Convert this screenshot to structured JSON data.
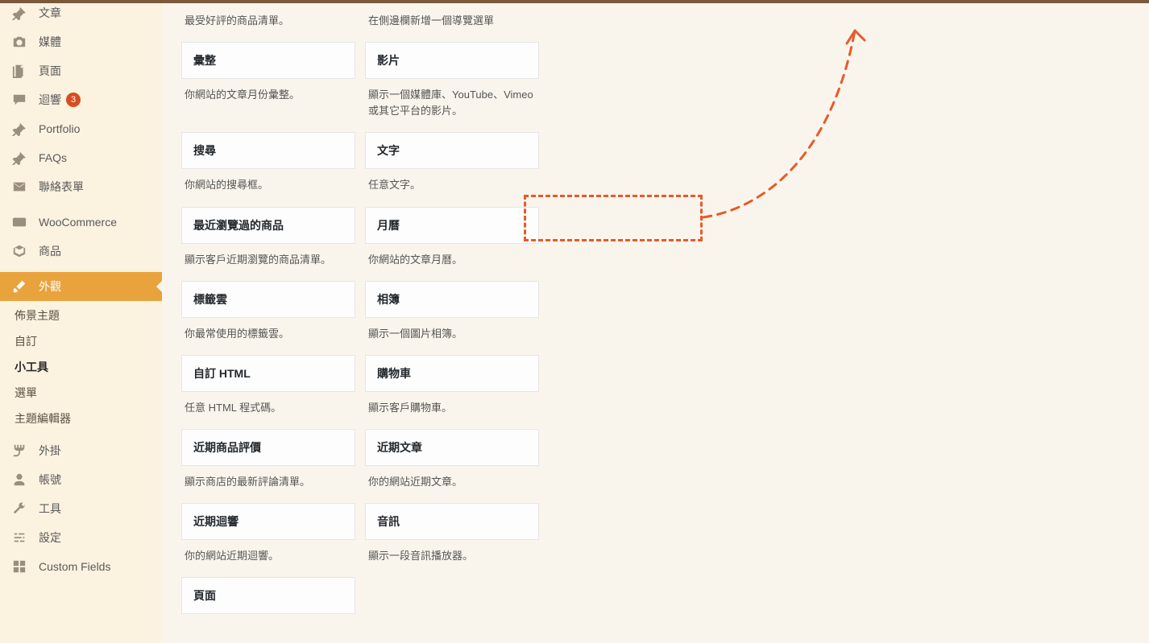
{
  "sidebar": {
    "items": [
      {
        "key": "posts",
        "label": "文章",
        "icon": "pin",
        "partial_top": true
      },
      {
        "key": "media",
        "label": "媒體",
        "icon": "camera"
      },
      {
        "key": "pages",
        "label": "頁面",
        "icon": "pages"
      },
      {
        "key": "comments",
        "label": "迴響",
        "icon": "comment",
        "badge": "3"
      },
      {
        "key": "portfolio",
        "label": "Portfolio",
        "icon": "pin"
      },
      {
        "key": "faqs",
        "label": "FAQs",
        "icon": "pin"
      },
      {
        "key": "contact",
        "label": "聯絡表單",
        "icon": "mail"
      },
      {
        "separator": true
      },
      {
        "key": "woocommerce",
        "label": "WooCommerce",
        "icon": "woo"
      },
      {
        "key": "products",
        "label": "商品",
        "icon": "box"
      },
      {
        "separator": true
      },
      {
        "key": "appearance",
        "label": "外觀",
        "icon": "brush",
        "active": true
      }
    ],
    "submenu": [
      {
        "label": "佈景主題"
      },
      {
        "label": "自訂"
      },
      {
        "label": "小工具",
        "current": true
      },
      {
        "label": "選單"
      },
      {
        "label": "主題編輯器"
      }
    ],
    "items_after": [
      {
        "key": "plugins",
        "label": "外掛",
        "icon": "plug"
      },
      {
        "key": "users",
        "label": "帳號",
        "icon": "user"
      },
      {
        "key": "tools",
        "label": "工具",
        "icon": "wrench"
      },
      {
        "key": "settings",
        "label": "設定",
        "icon": "sliders"
      },
      {
        "key": "custom-fields",
        "label": "Custom Fields",
        "icon": "grid"
      }
    ]
  },
  "widgets": {
    "row0": {
      "left_desc": "最受好評的商品清單。",
      "right_desc": "在側邊欄新增一個導覽選單"
    },
    "rows": [
      {
        "left": {
          "title": "彙整",
          "desc": "你網站的文章月份彙整。"
        },
        "right": {
          "title": "影片",
          "desc": "顯示一個媒體庫、YouTube、Vimeo 或其它平台的影片。"
        }
      },
      {
        "left": {
          "title": "搜尋",
          "desc": "你網站的搜尋框。"
        },
        "right": {
          "title": "文字",
          "desc": "任意文字。"
        }
      },
      {
        "left": {
          "title": "最近瀏覽過的商品",
          "desc": "顯示客戶近期瀏覽的商品清單。"
        },
        "right": {
          "title": "月曆",
          "desc": "你網站的文章月曆。",
          "highlighted": true
        }
      },
      {
        "left": {
          "title": "標籤雲",
          "desc": "你最常使用的標籤雲。"
        },
        "right": {
          "title": "相簿",
          "desc": "顯示一個圖片相簿。"
        }
      },
      {
        "left": {
          "title": "自訂 HTML",
          "desc": "任意 HTML 程式碼。"
        },
        "right": {
          "title": "購物車",
          "desc": "顯示客戶購物車。"
        }
      },
      {
        "left": {
          "title": "近期商品評價",
          "desc": "顯示商店的最新評論清單。"
        },
        "right": {
          "title": "近期文章",
          "desc": "你的網站近期文章。"
        }
      },
      {
        "left": {
          "title": "近期迴響",
          "desc": "你的網站近期迴響。"
        },
        "right": {
          "title": "音訊",
          "desc": "顯示一段音訊播放器。"
        }
      },
      {
        "left": {
          "title": "頁面",
          "desc": ""
        },
        "right": null
      }
    ]
  },
  "annotation": {
    "highlight_color": "#e85a2a"
  }
}
